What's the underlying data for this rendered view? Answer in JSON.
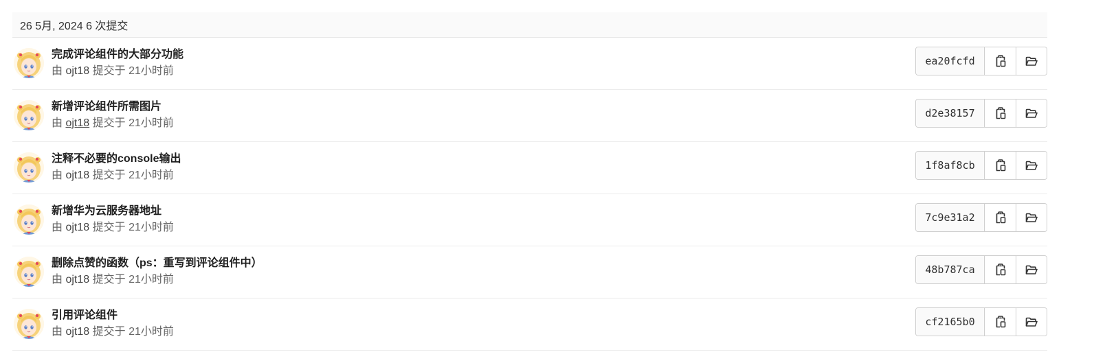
{
  "day_header": "26 5月, 2024 6 次提交",
  "commits": [
    {
      "title": "完成评论组件的大部分功能",
      "by_prefix": "由",
      "author": "ojt18",
      "committed": "提交于 21小时前",
      "sha": "ea20fcfd"
    },
    {
      "title": "新增评论组件所需图片",
      "by_prefix": "由",
      "author": "ojt18",
      "committed": "提交于 21小时前",
      "sha": "d2e38157"
    },
    {
      "title": "注释不必要的console输出",
      "by_prefix": "由",
      "author": "ojt18",
      "committed": "提交于 21小时前",
      "sha": "1f8af8cb"
    },
    {
      "title": "新增华为云服务器地址",
      "by_prefix": "由",
      "author": "ojt18",
      "committed": "提交于 21小时前",
      "sha": "7c9e31a2"
    },
    {
      "title": "删除点赞的函数（ps：重写到评论组件中）",
      "by_prefix": "由",
      "author": "ojt18",
      "committed": "提交于 21小时前",
      "sha": "48b787ca"
    },
    {
      "title": "引用评论组件",
      "by_prefix": "由",
      "author": "ojt18",
      "committed": "提交于 21小时前",
      "sha": "cf2165b0"
    }
  ],
  "icons": {
    "avatar": "user-avatar",
    "copy": "clipboard-icon",
    "browse": "folder-open-icon"
  }
}
